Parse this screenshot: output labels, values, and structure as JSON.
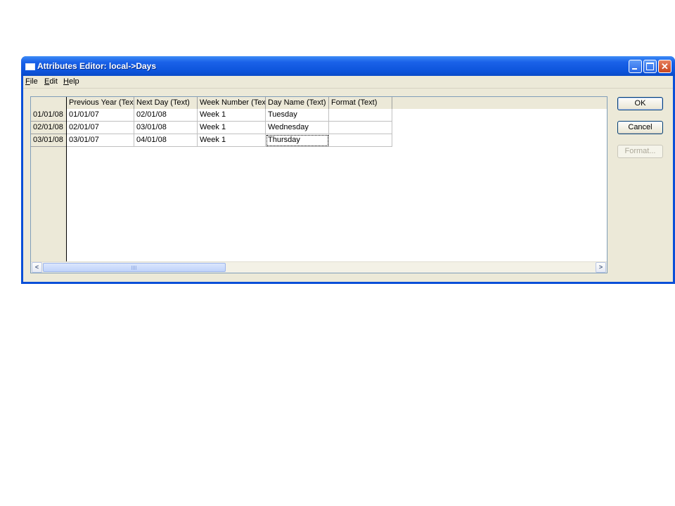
{
  "window": {
    "title": "Attributes Editor: local->Days"
  },
  "menu": {
    "file_prefix": "F",
    "file_rest": "ile",
    "edit_prefix": "E",
    "edit_rest": "dit",
    "help_prefix": "H",
    "help_rest": "elp"
  },
  "grid": {
    "columns": [
      "Previous Year (Text)",
      "Next Day (Text)",
      "Week Number (Text)",
      "Day Name (Text)",
      "Format (Text)"
    ],
    "rows": [
      {
        "key": "01/01/08",
        "cells": [
          "01/01/07",
          "02/01/08",
          "Week 1",
          "Tuesday",
          ""
        ]
      },
      {
        "key": "02/01/08",
        "cells": [
          "02/01/07",
          "03/01/08",
          "Week 1",
          "Wednesday",
          ""
        ]
      },
      {
        "key": "03/01/08",
        "cells": [
          "03/01/07",
          "04/01/08",
          "Week 1",
          "Thursday",
          ""
        ]
      }
    ],
    "focused_row": 2,
    "focused_col": 3
  },
  "buttons": {
    "ok": "OK",
    "cancel": "Cancel",
    "format": "Format..."
  },
  "icons": {
    "minimize": "minimize-icon",
    "maximize": "maximize-icon",
    "close": "close-icon",
    "scroll_left": "chevron-left-icon",
    "scroll_right": "chevron-right-icon"
  }
}
